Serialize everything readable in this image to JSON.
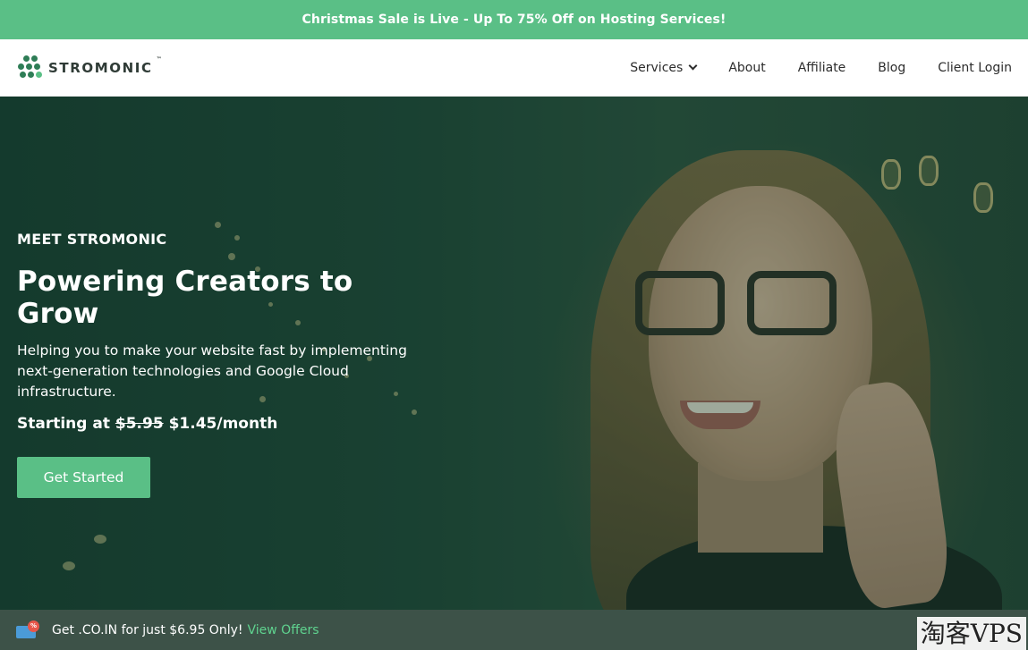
{
  "announcement": {
    "text": "Christmas Sale is Live - Up To 75% Off on Hosting Services!"
  },
  "brand": {
    "name": "STROMONIC",
    "tm": "™",
    "logo_icon": "dots-grid-icon"
  },
  "nav": {
    "items": [
      {
        "label": "Services",
        "has_dropdown": true
      },
      {
        "label": "About"
      },
      {
        "label": "Affiliate"
      },
      {
        "label": "Blog"
      },
      {
        "label": "Client Login"
      }
    ]
  },
  "hero": {
    "kicker": "MEET STROMONIC",
    "headline": "Powering Creators to Grow",
    "subtext": "Helping you to make your website fast by implementing next-generation technologies and Google Cloud infrastructure.",
    "price_prefix": "Starting at",
    "old_price": "$5.95",
    "new_price": "$1.45/month",
    "cta_label": "Get Started"
  },
  "offer": {
    "icon": "domain-tag-icon",
    "badge": "%",
    "text": "Get .CO.IN for just $6.95 Only!",
    "link_label": "View Offers"
  },
  "watermark": {
    "text": "淘客VPS"
  },
  "colors": {
    "accent": "#5abf86",
    "link": "#5fd38f",
    "offer_bar": "#3d5248",
    "text_dark": "#2c2c2c"
  }
}
